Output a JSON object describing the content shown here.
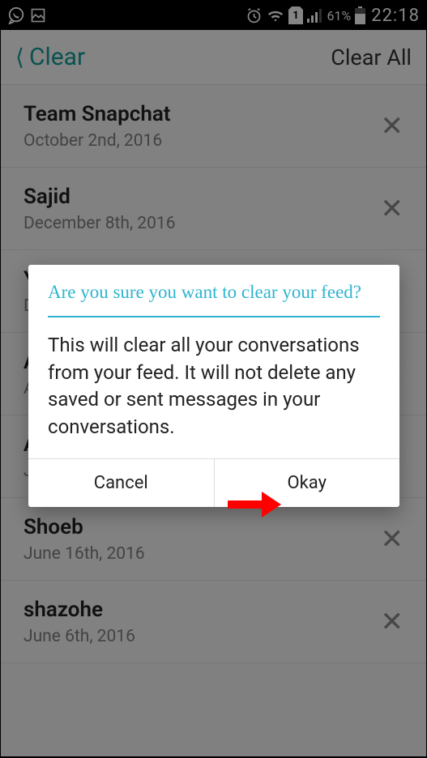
{
  "statusbar": {
    "battery_pct": "61%",
    "clock": "22:18"
  },
  "header": {
    "title": "Clear",
    "clear_all": "Clear All"
  },
  "rows": [
    {
      "name": "Team Snapchat",
      "date": "October 2nd, 2016"
    },
    {
      "name": "Sajid",
      "date": "December 8th, 2016"
    },
    {
      "name": "Y",
      "date": "D"
    },
    {
      "name": "A",
      "date": "A"
    },
    {
      "name": "A",
      "date": "J"
    },
    {
      "name": "Shoeb",
      "date": "June 16th, 2016"
    },
    {
      "name": "shazohe",
      "date": "June 6th, 2016"
    }
  ],
  "dialog": {
    "title": "Are you sure you want to clear your feed?",
    "body": "This will clear all your conversations from your feed. It will not delete any saved or sent messages in your conversations.",
    "cancel": "Cancel",
    "okay": "Okay"
  }
}
